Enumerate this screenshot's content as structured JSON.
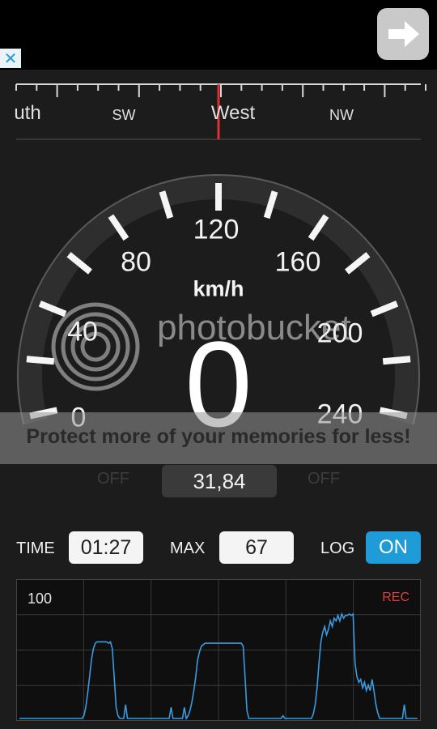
{
  "ad": {
    "close_glyph": "✕",
    "next_icon": "arrow-right-icon"
  },
  "compass": {
    "labels": [
      "uth",
      "SW",
      "West",
      "NW"
    ],
    "needle_color": "#e03030"
  },
  "gauge": {
    "scale_labels": [
      "0",
      "40",
      "80",
      "120",
      "160",
      "200",
      "240"
    ],
    "unit": "km/h",
    "speed": "0",
    "off_left": "OFF",
    "off_right": "OFF",
    "distance": "31,84"
  },
  "watermark": {
    "brand": "photobucket",
    "tagline": "Protect more of your memories for less!"
  },
  "controls": {
    "time_label": "TIME",
    "time_value": "01:27",
    "max_label": "MAX",
    "max_value": "67",
    "log_label": "LOG",
    "log_value": "ON",
    "accent": "#1f9bd7"
  },
  "graph": {
    "y_max_label": "100",
    "rec_label": "REC",
    "rec_color": "#e23b3b",
    "line_color": "#3a9be0",
    "ymax": 100,
    "samples": [
      0,
      0,
      0,
      0,
      0,
      0,
      0,
      0,
      0,
      0,
      0,
      0,
      0,
      0,
      0,
      0,
      0,
      0,
      0,
      0,
      0,
      0,
      0,
      0,
      0,
      0,
      0,
      0,
      0,
      0,
      0,
      0,
      0,
      0,
      2,
      8,
      18,
      30,
      42,
      50,
      54,
      55,
      55,
      55,
      55,
      55,
      55,
      54,
      55,
      50,
      30,
      8,
      2,
      0,
      0,
      0,
      10,
      0,
      0,
      0,
      0,
      0,
      0,
      0,
      0,
      0,
      0,
      0,
      0,
      0,
      0,
      0,
      0,
      0,
      0,
      0,
      0,
      0,
      0,
      0,
      8,
      0,
      0,
      0,
      0,
      0,
      0,
      8,
      0,
      2,
      6,
      12,
      20,
      30,
      42,
      48,
      52,
      53,
      54,
      54,
      54,
      54,
      54,
      54,
      54,
      54,
      54,
      54,
      54,
      54,
      54,
      54,
      54,
      54,
      54,
      54,
      54,
      54,
      52,
      30,
      6,
      0,
      0,
      0,
      0,
      0,
      0,
      0,
      0,
      0,
      0,
      0,
      0,
      0,
      0,
      0,
      0,
      0,
      0,
      2,
      0,
      0,
      0,
      0,
      0,
      0,
      0,
      0,
      0,
      0,
      0,
      0,
      0,
      0,
      0,
      3,
      10,
      22,
      40,
      55,
      62,
      66,
      60,
      64,
      70,
      66,
      72,
      70,
      74,
      70,
      75,
      72,
      74,
      74,
      75,
      74,
      75,
      40,
      30,
      26,
      28,
      22,
      26,
      20,
      24,
      20,
      28,
      20,
      10,
      4,
      0,
      0,
      0,
      0,
      0,
      0,
      0,
      0,
      0,
      0,
      0,
      0,
      0,
      10,
      0,
      0,
      0,
      0,
      0,
      0,
      0
    ]
  }
}
